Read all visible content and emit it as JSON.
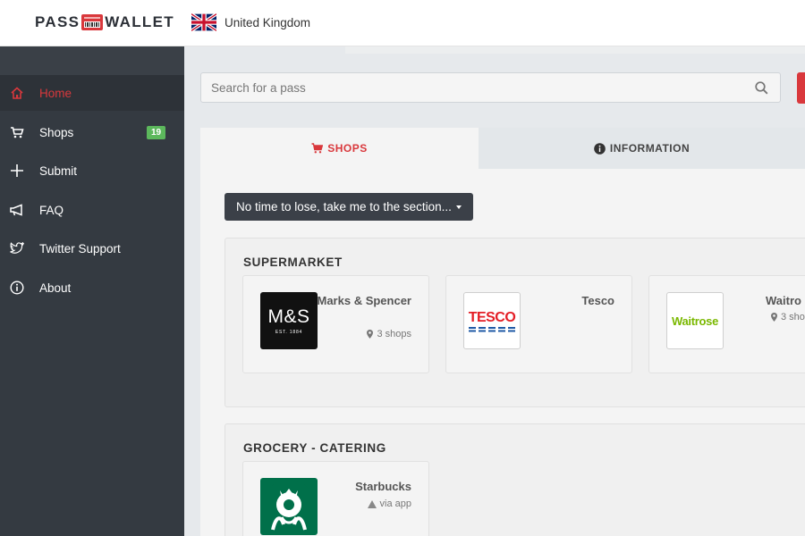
{
  "header": {
    "logo_left": "PASS",
    "logo_right": "WALLET",
    "country": "United Kingdom"
  },
  "sidebar": {
    "items": [
      {
        "label": "Home",
        "icon": "home-icon",
        "active": true
      },
      {
        "label": "Shops",
        "icon": "cart-icon",
        "badge": "19"
      },
      {
        "label": "Submit",
        "icon": "plus-icon"
      },
      {
        "label": "FAQ",
        "icon": "megaphone-icon"
      },
      {
        "label": "Twitter Support",
        "icon": "twitter-icon"
      },
      {
        "label": "About",
        "icon": "info-circle-icon"
      }
    ]
  },
  "search": {
    "placeholder": "Search for a pass",
    "value": ""
  },
  "tabs": [
    {
      "label": "SHOPS",
      "icon": "cart-icon",
      "active": true
    },
    {
      "label": "INFORMATION",
      "icon": "info-circle-icon",
      "active": false
    }
  ],
  "jump_button": {
    "label": "No time to lose, take me to the section..."
  },
  "sections": [
    {
      "title": "SUPERMARKET",
      "shops": [
        {
          "name": "Marks & Spencer",
          "meta": "3 shops",
          "meta_icon": "map-pin-icon",
          "logo_text": "M&S",
          "logo_sub": "EST. 1884"
        },
        {
          "name": "Tesco",
          "meta": "",
          "meta_icon": "",
          "logo_text": "TESCO"
        },
        {
          "name": "Waitro",
          "meta": "3 sho",
          "meta_icon": "map-pin-icon",
          "logo_text": "Waitrose"
        }
      ]
    },
    {
      "title": "GROCERY - CATERING",
      "shops": [
        {
          "name": "Starbucks",
          "meta": "via app",
          "meta_icon": "app-icon",
          "logo_text": ""
        }
      ]
    }
  ],
  "colors": {
    "accent": "#d9383c",
    "sidebar_bg": "#343a41",
    "badge_green": "#5cb85c",
    "dark_button": "#3b4048",
    "ms_black": "#111111",
    "tesco_red": "#e41e26",
    "tesco_blue": "#1f5aa6",
    "waitrose_green": "#7ab800",
    "starbucks_green": "#00704a"
  }
}
